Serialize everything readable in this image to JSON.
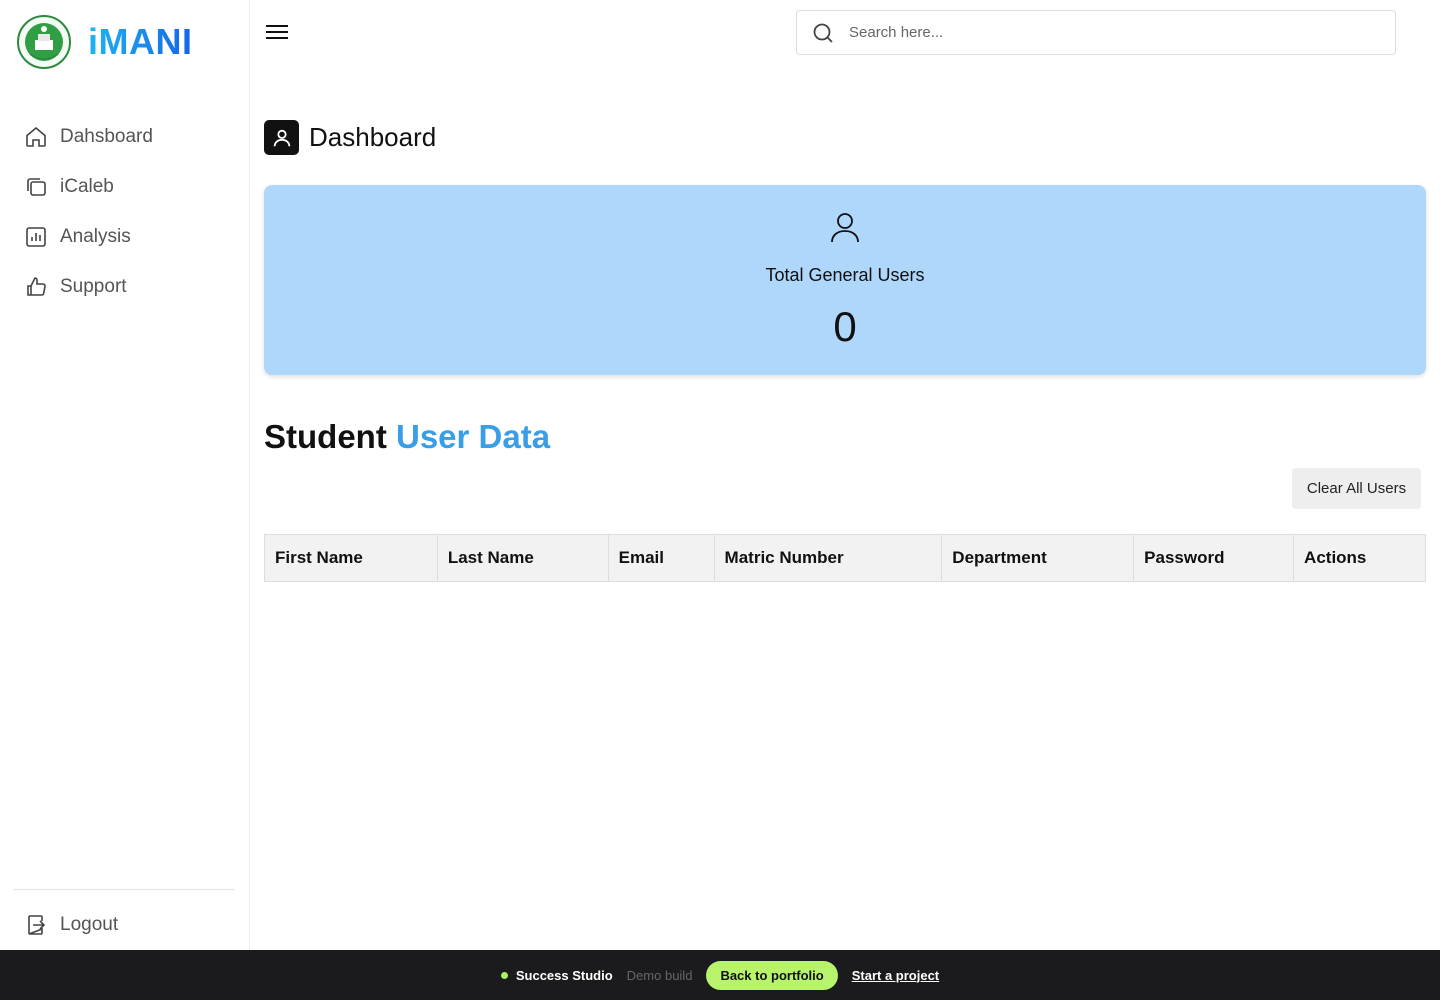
{
  "brand": {
    "name": "iMANI"
  },
  "sidebar": {
    "items": [
      {
        "label": "Dahsboard",
        "icon": "home-icon"
      },
      {
        "label": "iCaleb",
        "icon": "copy-icon"
      },
      {
        "label": "Analysis",
        "icon": "chart-icon"
      },
      {
        "label": "Support",
        "icon": "thumbs-up-icon"
      }
    ],
    "logout_label": "Logout"
  },
  "search": {
    "placeholder": "Search here..."
  },
  "page": {
    "title": "Dashboard"
  },
  "stat_card": {
    "label": "Total General Users",
    "value": "0"
  },
  "section": {
    "title_main": "Student",
    "title_accent": "User Data"
  },
  "clear_button": {
    "label": "Clear All Users"
  },
  "table": {
    "columns": [
      "First Name",
      "Last Name",
      "Email",
      "Matric Number",
      "Department",
      "Password",
      "Actions"
    ]
  },
  "footer": {
    "studio": "Success Studio",
    "build": "Demo build",
    "back_label": "Back to portfolio",
    "start_label": "Start a project"
  },
  "colors": {
    "brand_gradient_start": "#1fb5f0",
    "brand_gradient_end": "#1565e8",
    "stat_card_bg": "#afd6fb",
    "accent_text": "#3a9ee6",
    "footer_bg": "#1b1b1d",
    "footer_button": "#b7f36b"
  }
}
